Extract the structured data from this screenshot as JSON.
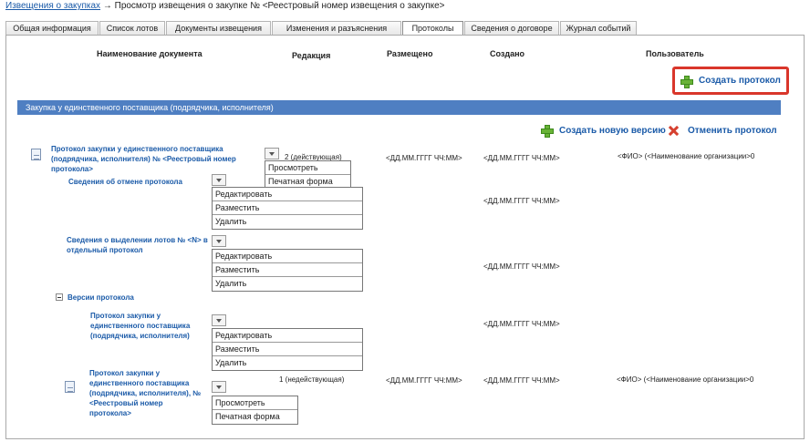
{
  "breadcrumb": {
    "link": "Извещения о закупках",
    "arrow": "→",
    "current": "Просмотр извещения о закупке № <Реестровый номер извещения о закупке>"
  },
  "tabs": [
    {
      "label": "Общая информация"
    },
    {
      "label": "Список лотов"
    },
    {
      "label": "Документы извещения"
    },
    {
      "label": "Изменения и разъяснения"
    },
    {
      "label": "Протоколы"
    },
    {
      "label": "Сведения о договоре"
    },
    {
      "label": "Журнал событий"
    }
  ],
  "columns": {
    "name": "Наименование документа",
    "edition": "Редакция",
    "placed": "Размещено",
    "created": "Создано",
    "user": "Пользователь"
  },
  "actions": {
    "create_protocol": "Создать протокол",
    "create_version": "Создать новую версию",
    "cancel_protocol": "Отменить протокол"
  },
  "section": {
    "title": "Закупка у единственного поставщика (подрядчика, исполнителя)"
  },
  "protocol": {
    "title": "Протокол закупки у единственного поставщика (подрядчика, исполнителя) № <Реестровый номер протокола>",
    "edition": "2 (действующая)",
    "placed": "<ДД.ММ.ГГГГ ЧЧ:ММ>",
    "created": "<ДД.ММ.ГГГГ ЧЧ:ММ>",
    "user": "<ФИО> (<Наименование организации>0",
    "menu": [
      "Просмотреть",
      "Печатная форма"
    ]
  },
  "cancel_info": {
    "title": "Сведения об отмене протокола",
    "created": "<ДД.ММ.ГГГГ ЧЧ:ММ>",
    "menu": [
      "Редактировать",
      "Разместить",
      "Удалить"
    ]
  },
  "lots_info": {
    "title": "Сведения о выделении лотов № <N> в отдельный протокол",
    "created": "<ДД.ММ.ГГГГ ЧЧ:ММ>",
    "menu": [
      "Редактировать",
      "Разместить",
      "Удалить"
    ]
  },
  "versions": {
    "label": "Версии протокола"
  },
  "version_draft": {
    "title": "Протокол закупки у единственного поставщика (подрядчика, исполнителя)",
    "created": "<ДД.ММ.ГГГГ ЧЧ:ММ>",
    "menu": [
      "Редактировать",
      "Разместить",
      "Удалить"
    ]
  },
  "version_old": {
    "title": "Протокол закупки у единственного поставщика (подрядчика, исполнителя), № <Реестровый номер протокола>",
    "edition": "1 (недействующая)",
    "placed": "<ДД.ММ.ГГГГ ЧЧ:ММ>",
    "created": "<ДД.ММ.ГГГГ ЧЧ:ММ>",
    "user": "<ФИО> (<Наименование организации>0",
    "menu": [
      "Просмотреть",
      "Печатная форма"
    ]
  }
}
